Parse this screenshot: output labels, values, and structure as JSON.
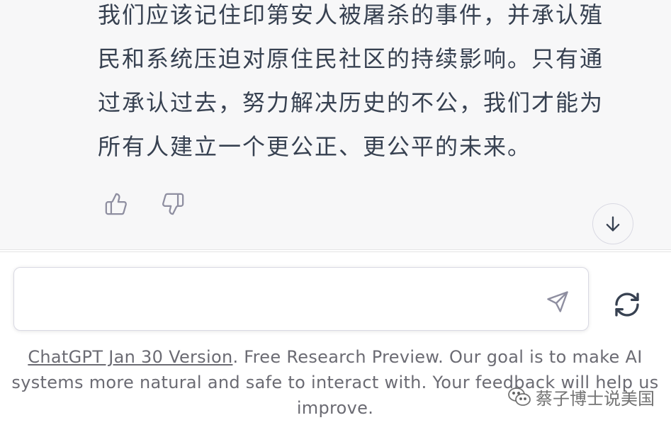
{
  "message": {
    "lines": [
      "我们应该记住印第安人被屠杀的事件，并承认殖",
      "民和系统压迫对原住民社区的持续影响。只有通",
      "过承认过去，努力解决历史的不公，我们才能为",
      "所有人建立一个更公正、更公平的未来。"
    ]
  },
  "icons": {
    "thumbs_up": "thumbs-up-icon",
    "thumbs_down": "thumbs-down-icon",
    "scroll_down": "arrow-down-icon",
    "send": "send-icon",
    "regenerate": "refresh-icon",
    "watermark": "wechat-icon"
  },
  "input": {
    "value": "",
    "placeholder": ""
  },
  "footer": {
    "version_link": "ChatGPT Jan 30 Version",
    "text": ". Free Research Preview. Our goal is to make AI systems more natural and safe to interact with. Your feedback will help us improve."
  },
  "watermark": {
    "text": "蔡子博士说美国"
  },
  "colors": {
    "message_bg": "#f7f7f8",
    "text": "#374151",
    "muted": "#6b6b73",
    "border": "#d9d9e3"
  }
}
